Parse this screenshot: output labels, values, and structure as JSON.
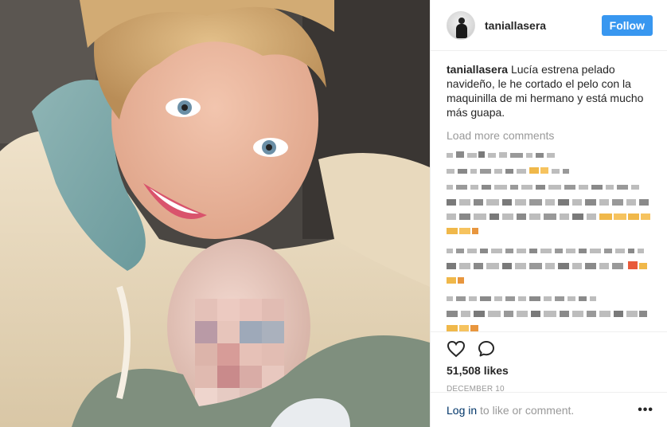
{
  "post": {
    "username": "taniallasera",
    "follow_label": "Follow",
    "caption_user": "taniallasera",
    "caption_text": "Lucía estrena pelado navideño, le he cortado el pelo con la maquinilla de mi hermano y está mucho más guapa.",
    "load_more_label": "Load more comments",
    "likes": "51,508 likes",
    "date": "DECEMBER 10",
    "login_link": "Log in",
    "login_suffix": " to like or comment.",
    "more_label": "•••"
  },
  "colors": {
    "accent": "#3897f0",
    "muted": "#999999",
    "link": "#003569",
    "text": "#262626"
  },
  "icons": {
    "like": "heart-icon",
    "comment": "comment-icon",
    "more": "more-options-icon"
  }
}
